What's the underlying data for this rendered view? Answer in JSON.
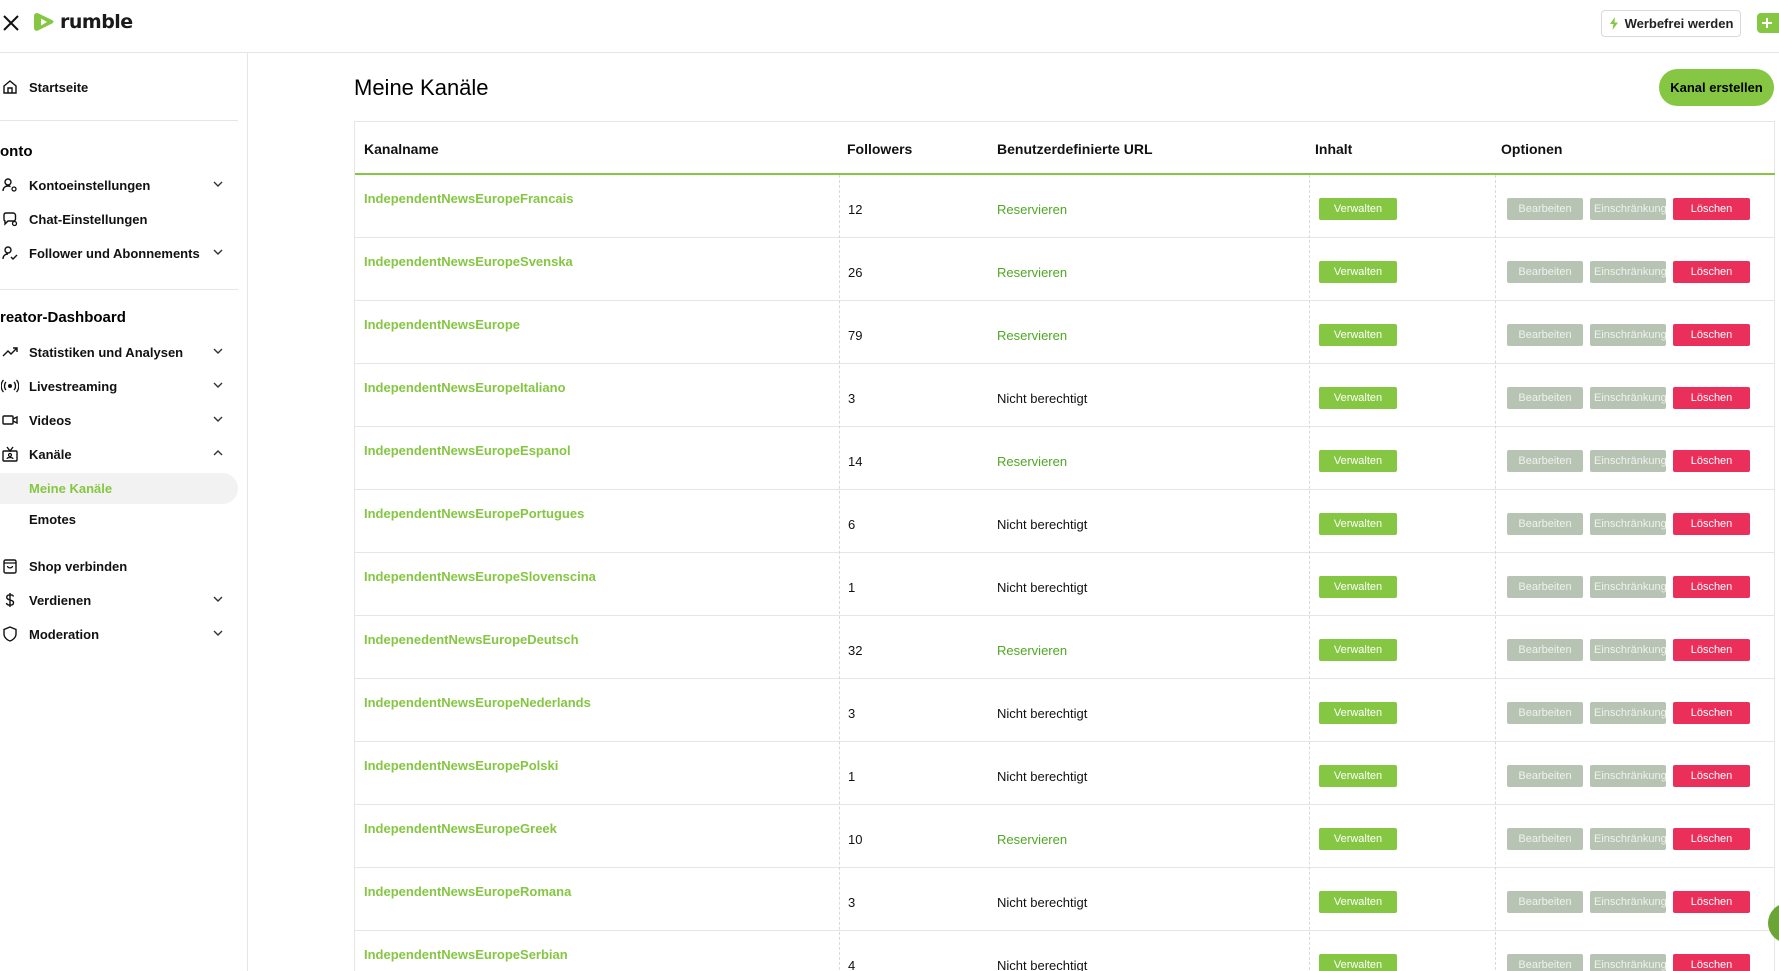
{
  "header": {
    "logo_text": "rumble",
    "adfree_label": "Werbefrei werden",
    "brand_color": "#85c742"
  },
  "sidebar": {
    "home": "Startseite",
    "account_section": "onto",
    "account_items": [
      {
        "label": "Kontoeinstellungen",
        "icon": "user-gear-icon",
        "chevron": true
      },
      {
        "label": "Chat-Einstellungen",
        "icon": "chat-gear-icon",
        "chevron": false
      },
      {
        "label": "Follower und Abonnements",
        "icon": "user-check-icon",
        "chevron": true
      }
    ],
    "creator_section": "reator-Dashboard",
    "creator_items": [
      {
        "label": "Statistiken und Analysen",
        "icon": "trend-icon",
        "chevron": "down"
      },
      {
        "label": "Livestreaming",
        "icon": "broadcast-icon",
        "chevron": "down"
      },
      {
        "label": "Videos",
        "icon": "video-icon",
        "chevron": "down"
      },
      {
        "label": "Kanäle",
        "icon": "channel-icon",
        "chevron": "up"
      }
    ],
    "channel_subitems": [
      "Meine Kanäle",
      "Emotes"
    ],
    "bottom_items": [
      {
        "label": "Shop verbinden",
        "icon": "shop-bag-icon",
        "chevron": false
      },
      {
        "label": "Verdienen",
        "icon": "dollar-icon",
        "chevron": true
      },
      {
        "label": "Moderation",
        "icon": "shield-icon",
        "chevron": true
      }
    ]
  },
  "main": {
    "title": "Meine Kanäle",
    "create_label": "Kanal erstellen",
    "columns": [
      "Kanalname",
      "Followers",
      "Benutzerdefinierte URL",
      "Inhalt",
      "Optionen"
    ],
    "button_labels": {
      "manage": "Verwalten",
      "edit": "Bearbeiten",
      "restrict": "Einschränkung",
      "delete": "Löschen"
    },
    "rows": [
      {
        "name": "IndependentNewsEuropeFrancais",
        "followers": "12",
        "url": "Reservieren",
        "reservable": true
      },
      {
        "name": "IndependentNewsEuropeSvenska",
        "followers": "26",
        "url": "Reservieren",
        "reservable": true
      },
      {
        "name": "IndependentNewsEurope",
        "followers": "79",
        "url": "Reservieren",
        "reservable": true
      },
      {
        "name": "IndependentNewsEuropeItaliano",
        "followers": "3",
        "url": "Nicht berechtigt",
        "reservable": false
      },
      {
        "name": "IndependentNewsEuropeEspanol",
        "followers": "14",
        "url": "Reservieren",
        "reservable": true
      },
      {
        "name": "IndependentNewsEuropePortugues",
        "followers": "6",
        "url": "Nicht berechtigt",
        "reservable": false
      },
      {
        "name": "IndependentNewsEuropeSlovenscina",
        "followers": "1",
        "url": "Nicht berechtigt",
        "reservable": false
      },
      {
        "name": "IndepenedentNewsEuropeDeutsch",
        "followers": "32",
        "url": "Reservieren",
        "reservable": true
      },
      {
        "name": "IndependentNewsEuropeNederlands",
        "followers": "3",
        "url": "Nicht berechtigt",
        "reservable": false
      },
      {
        "name": "IndependentNewsEuropePolski",
        "followers": "1",
        "url": "Nicht berechtigt",
        "reservable": false
      },
      {
        "name": "IndependentNewsEuropeGreek",
        "followers": "10",
        "url": "Reservieren",
        "reservable": true
      },
      {
        "name": "IndependentNewsEuropeRomana",
        "followers": "3",
        "url": "Nicht berechtigt",
        "reservable": false
      },
      {
        "name": "IndependentNewsEuropeSerbian",
        "followers": "4",
        "url": "Nicht berechtigt",
        "reservable": false
      }
    ]
  }
}
